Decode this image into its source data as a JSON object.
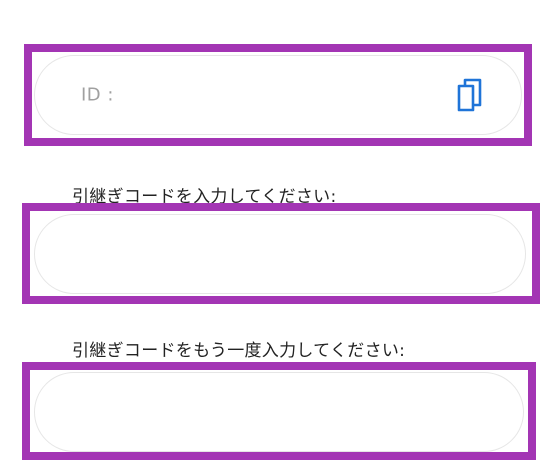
{
  "id_field": {
    "label": "ID :",
    "value": "",
    "copy_icon": "copy-icon",
    "icon_color": "#1f74d8"
  },
  "code_field": {
    "label": "引継ぎコードを入力してください:",
    "value": ""
  },
  "confirm_field": {
    "label": "引継ぎコードをもう一度入力してください:",
    "value": ""
  },
  "colors": {
    "highlight_frame": "#a335b4",
    "field_border": "#e6e6e6",
    "label_text": "#222222",
    "placeholder_text": "#a0a0a0"
  }
}
